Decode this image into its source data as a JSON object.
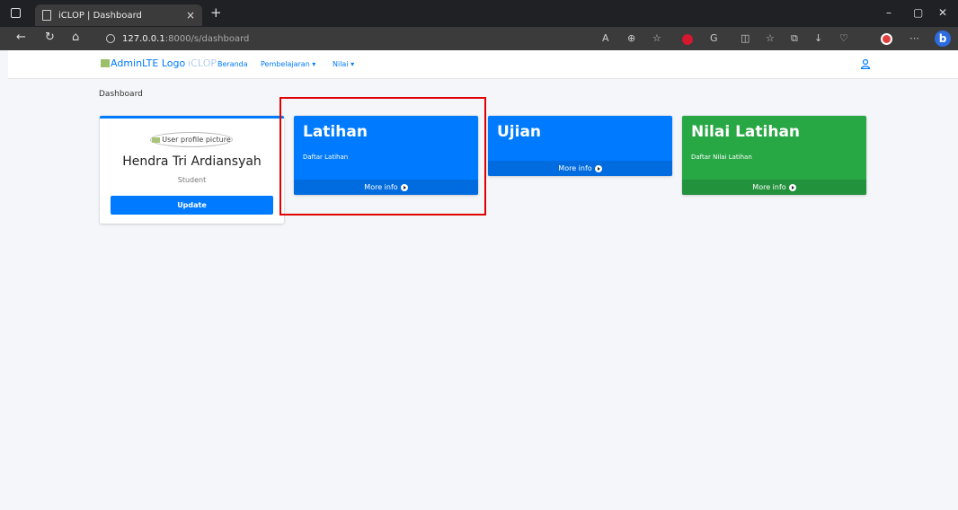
{
  "browser": {
    "tab_title": "iCLOP | Dashboard",
    "tab_close": "×",
    "new_tab": "+",
    "url_host": "127.0.0.1",
    "url_path": ":8000/s/dashboard",
    "window_controls": [
      "–",
      "▢",
      "✕"
    ]
  },
  "navbar": {
    "logo_alt": "AdminLTE Logo",
    "brand": "iCLOP",
    "links": [
      {
        "label": "Beranda"
      },
      {
        "label": "Pembelajaran ▾"
      },
      {
        "label": "Nilai ▾"
      }
    ]
  },
  "page": {
    "title": "Dashboard"
  },
  "profile": {
    "picture_alt": "User profile picture",
    "name": "Hendra Tri Ardiansyah",
    "role": "Student",
    "update_label": "Update"
  },
  "boxes": [
    {
      "title": "Latihan",
      "subtitle": "Daftar Latihan",
      "footer": "More info",
      "color": "#007bff"
    },
    {
      "title": "Ujian",
      "subtitle": "",
      "footer": "More info",
      "color": "#007bff"
    },
    {
      "title": "Nilai Latihan",
      "subtitle": "Daftar Nilai Latihan",
      "footer": "More info",
      "color": "#28a745"
    }
  ],
  "colors": {
    "primary": "#007bff",
    "success": "#28a745",
    "highlight": "#e00000"
  }
}
